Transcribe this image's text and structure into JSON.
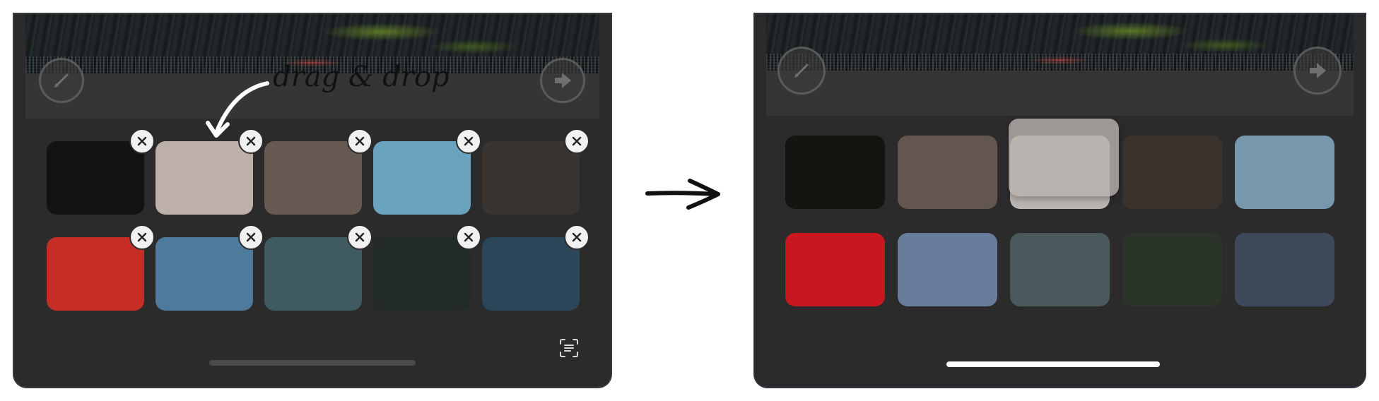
{
  "annotation": {
    "label": "drag & drop"
  },
  "before": {
    "icons": {
      "left": "pencil-icon",
      "right": "arrow-right-icon",
      "bottom": "text-scan-icon"
    },
    "swatches": [
      {
        "color": "#111413"
      },
      {
        "color": "#bdb0a8"
      },
      {
        "color": "#675a52"
      },
      {
        "color": "#6ba3bd"
      },
      {
        "color": "#39342f"
      },
      {
        "color": "#c62d25"
      },
      {
        "color": "#4e7a9c"
      },
      {
        "color": "#3f5b61"
      },
      {
        "color": "#222b28"
      },
      {
        "color": "#2b4559"
      }
    ]
  },
  "after": {
    "icons": {
      "left": "pencil-icon",
      "right": "arrow-right-icon"
    },
    "swatches": [
      {
        "color": "#151410"
      },
      {
        "color": "#635650"
      },
      {
        "color": "#b9b5b2"
      },
      {
        "color": "#3a322c"
      },
      {
        "color": "#7797ad"
      },
      {
        "color": "#c8171f"
      },
      {
        "color": "#677d9b"
      },
      {
        "color": "#49595c"
      },
      {
        "color": "#2b3428"
      },
      {
        "color": "#3e4a5c"
      }
    ],
    "dragged_swatch": {
      "color": "#bab4b0"
    }
  },
  "colors": {
    "dark_bg": "#2b2b2b",
    "toolbar_bg": "#353535",
    "home_bar_left": "#4a4a4a",
    "home_bar_right": "#ffffff"
  }
}
